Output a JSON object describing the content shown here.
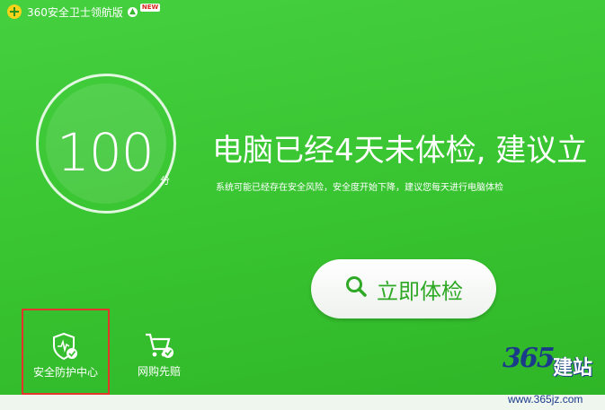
{
  "window": {
    "title": "360安全卫士领航版",
    "new_badge": "NEW"
  },
  "score": {
    "value": "100",
    "unit": "分"
  },
  "status": {
    "headline": "电脑已经4天未体检, 建议立",
    "subline": "系统可能已经存在安全风险，安全度开始下降，建议您每天进行电脑体检"
  },
  "actions": {
    "scan_label": "立即体检"
  },
  "tools": [
    {
      "label": "安全防护中心",
      "icon": "shield-icon"
    },
    {
      "label": "网购先赔",
      "icon": "shopping-cart-icon"
    }
  ],
  "watermark": {
    "number": "365",
    "chars": "建站",
    "url": "www.365jz.com"
  },
  "colors": {
    "background": "#38c330",
    "highlight_border": "#e2352c",
    "button_text": "#2ea825"
  }
}
